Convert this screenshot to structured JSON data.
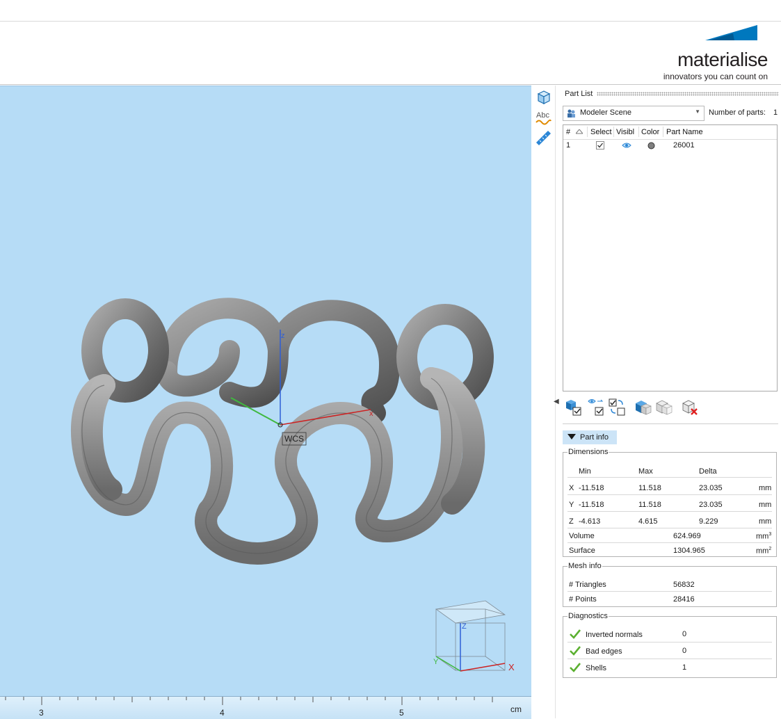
{
  "brand": {
    "name": "materialise",
    "tagline": "innovators you can count on",
    "accent": "#0078be"
  },
  "viewport": {
    "background": "#b6dcf6",
    "axis_labels": {
      "x": "x",
      "z": "z",
      "wcs": "WCS"
    },
    "orient_cube": {
      "x": "X",
      "z": "Z",
      "y": "Y"
    },
    "ruler": {
      "ticks": [
        "3",
        "4",
        "5"
      ],
      "unit": "cm"
    }
  },
  "side_tools": [
    "view-cube-icon",
    "text-annotation-icon",
    "measure-ruler-icon"
  ],
  "part_list": {
    "title": "Part List",
    "scene": "Modeler Scene",
    "number_label": "Number of parts:",
    "number_value": "1",
    "columns": [
      "#",
      "Select",
      "Visibl",
      "Color",
      "Part Name"
    ],
    "rows": [
      {
        "index": "1",
        "selected": true,
        "visible": true,
        "color": "#808080",
        "name": "26001"
      }
    ]
  },
  "part_info": {
    "title": "Part info",
    "dimensions": {
      "legend": "Dimensions",
      "headers": [
        "Min",
        "Max",
        "Delta"
      ],
      "rows": [
        {
          "axis": "X",
          "min": "-11.518",
          "max": "11.518",
          "delta": "23.035",
          "unit": "mm"
        },
        {
          "axis": "Y",
          "min": "-11.518",
          "max": "11.518",
          "delta": "23.035",
          "unit": "mm"
        },
        {
          "axis": "Z",
          "min": "-4.613",
          "max": "4.615",
          "delta": "9.229",
          "unit": "mm"
        }
      ],
      "volume_label": "Volume",
      "volume": "624.969",
      "volume_unit": "mm",
      "surface_label": "Surface",
      "surface": "1304.965",
      "surface_unit": "mm"
    },
    "mesh": {
      "legend": "Mesh info",
      "triangles_label": "# Triangles",
      "triangles": "56832",
      "points_label": "# Points",
      "points": "28416"
    },
    "diagnostics": {
      "legend": "Diagnostics",
      "items": [
        {
          "label": "Inverted normals",
          "value": "0"
        },
        {
          "label": "Bad edges",
          "value": "0"
        },
        {
          "label": "Shells",
          "value": "1"
        }
      ]
    }
  }
}
